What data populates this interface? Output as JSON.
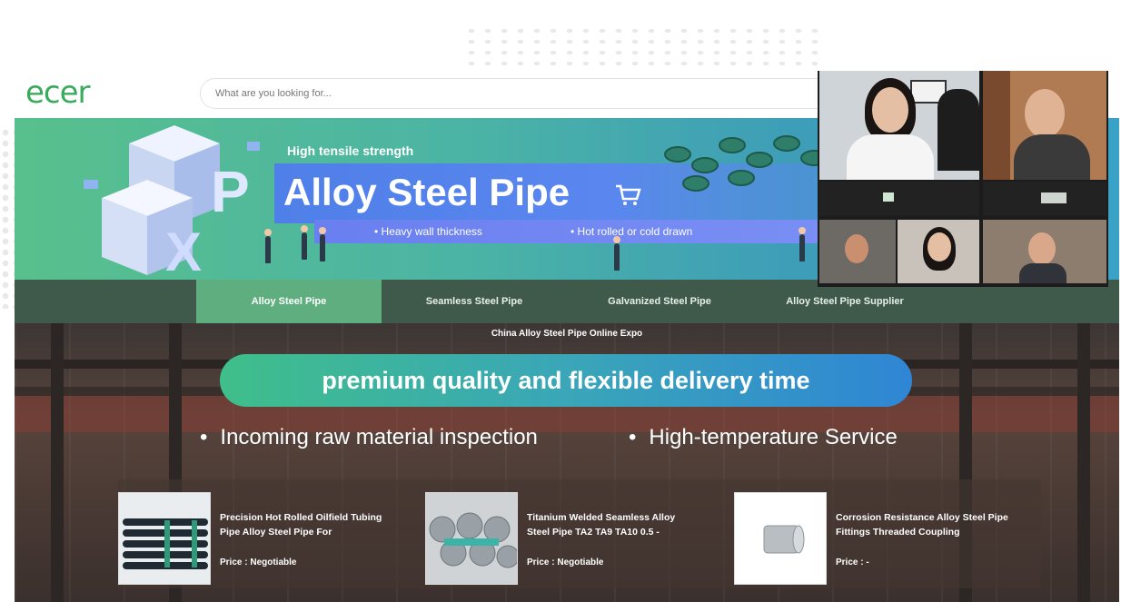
{
  "header": {
    "logo": "ecer",
    "search_placeholder": "What are you looking for..."
  },
  "banner": {
    "tagline": "High tensile strength",
    "title": "Alloy Steel Pipe",
    "bullets": [
      "• Heavy wall thickness",
      "• Hot rolled or cold drawn"
    ]
  },
  "nav": {
    "items": [
      "Alloy Steel Pipe",
      "Seamless Steel Pipe",
      "Galvanized Steel Pipe",
      "Alloy Steel Pipe Supplier"
    ],
    "active_index": 0
  },
  "hero": {
    "subtitle": "China Alloy Steel Pipe Online Expo",
    "headline": "premium quality and flexible delivery time",
    "features": [
      "Incoming raw material inspection",
      "High-temperature Service"
    ]
  },
  "products": [
    {
      "title": "Precision Hot Rolled Oilfield Tubing Pipe Alloy Steel Pipe For",
      "price": "Price : Negotiable"
    },
    {
      "title": "Titanium Welded Seamless Alloy Steel Pipe TA2 TA9 TA10 0.5 -",
      "price": "Price : Negotiable"
    },
    {
      "title": "Corrosion Resistance Alloy Steel Pipe Fittings Threaded Coupling",
      "price": "Price : -"
    }
  ],
  "colors": {
    "brand_green": "#3aaa5c",
    "nav_bg": "#3f5a4a",
    "nav_active": "#5fae80"
  }
}
